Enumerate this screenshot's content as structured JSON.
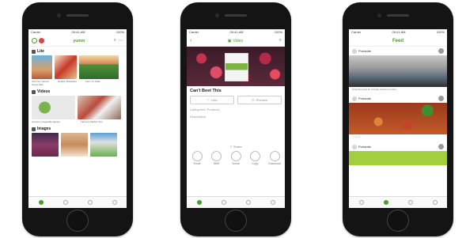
{
  "phone1": {
    "status_left": "Carrier",
    "status_time": "09:41 AM",
    "status_right": "100%",
    "brand": "yumm",
    "sections": [
      {
        "title": "Lite",
        "captions": [
          "Summer Fitness Game Plan",
          "Healthy Breakfast",
          "Farm To Table"
        ]
      },
      {
        "title": "Videos",
        "captions": [
          "Gourmet Vegetable Recipe",
          "Farmers Market Tour"
        ]
      },
      {
        "title": "Images",
        "captions": []
      }
    ]
  },
  "phone2": {
    "status_left": "Carrier",
    "status_time": "09:41 AM",
    "status_right": "100%",
    "nav_title": "Video",
    "item_title": "Can't Beet This",
    "like_label": "Like",
    "preview_label": "Preview",
    "field1": "Categories: Products",
    "field2": "Description",
    "share_label": "Share",
    "share_items": [
      "Email",
      "SMS",
      "Social",
      "Copy",
      "Download"
    ]
  },
  "phone3": {
    "status_left": "Carrier",
    "status_time": "09:41 AM",
    "status_right": "100%",
    "nav_title": "Feed",
    "posts": [
      {
        "author": "Portanite",
        "text": "Stretching tips for a better workout routine"
      },
      {
        "author": "Portanite",
        "text": ""
      },
      {
        "author": "Portanite",
        "text": ""
      }
    ]
  },
  "colors": {
    "accent": "#4a9e2f"
  }
}
